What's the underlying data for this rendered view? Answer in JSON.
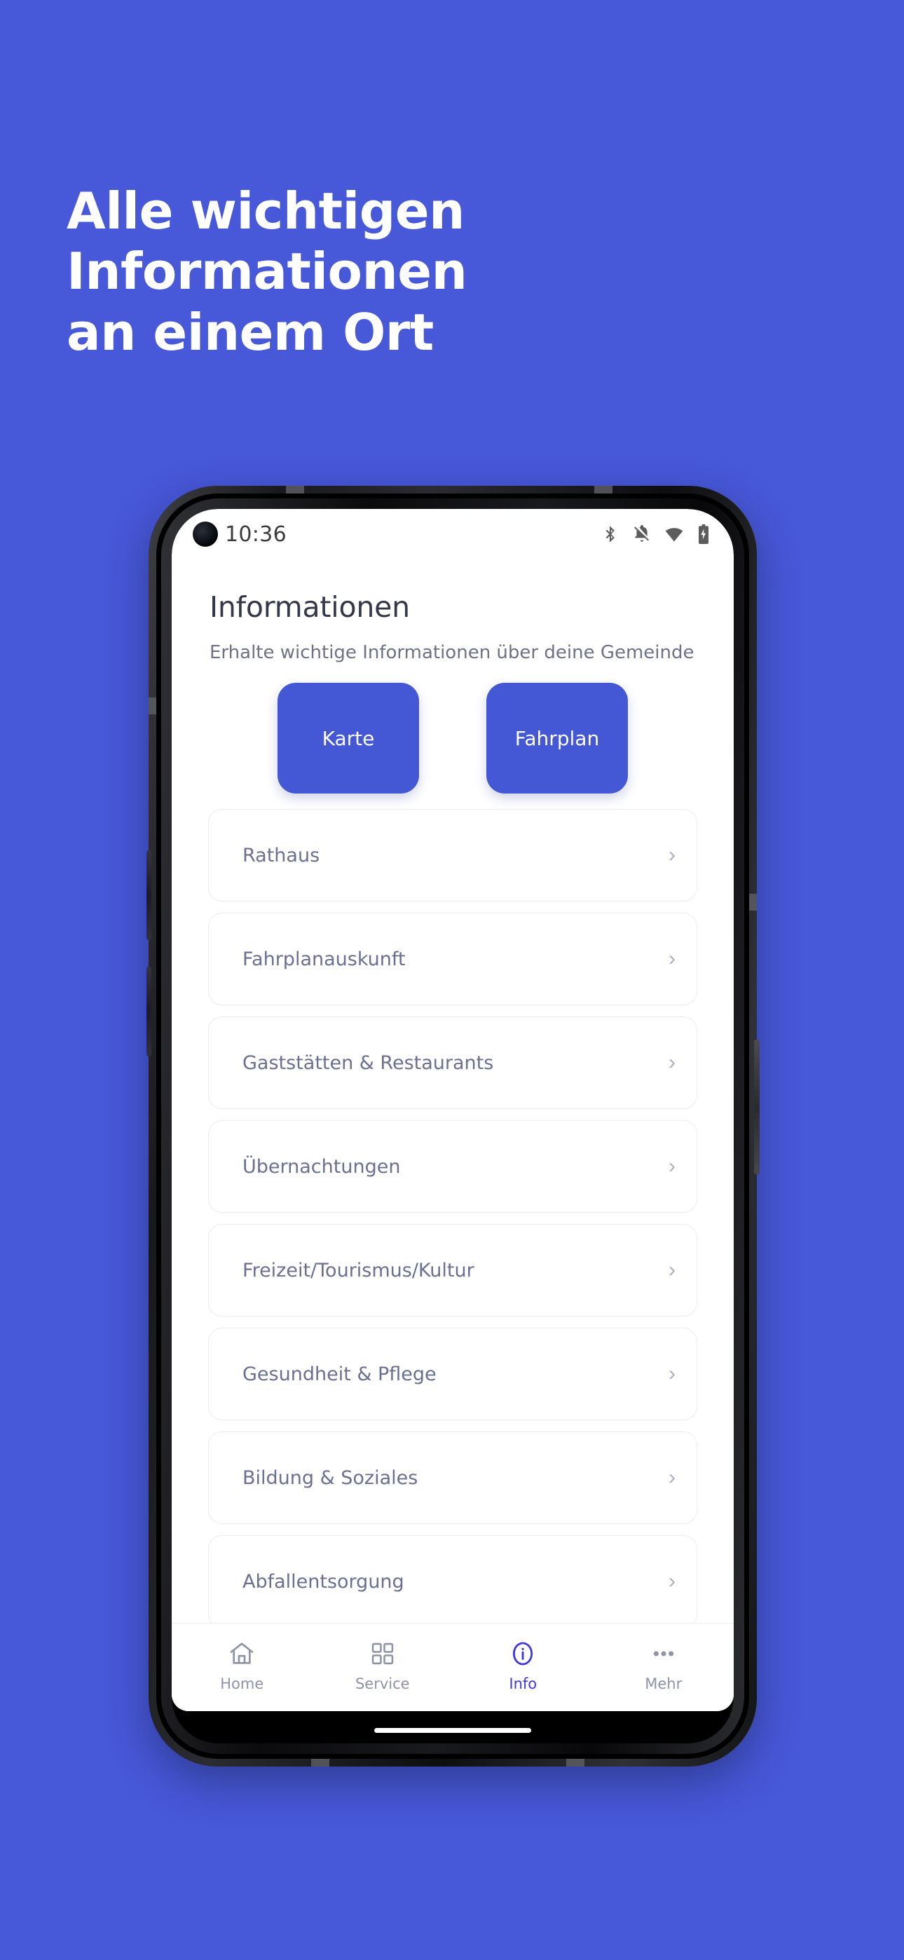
{
  "page": {
    "background_color": "#4758D8",
    "headline": "Alle wichtigen Informationen\nan einem Ort"
  },
  "phone": {
    "statusbar": {
      "time": "10:36",
      "icons": [
        "bluetooth-icon",
        "notifications-off-icon",
        "wifi-icon",
        "battery-charging-icon"
      ]
    },
    "app": {
      "title": "Informationen",
      "subtitle": "Erhalte wichtige Informationen über deine Gemeinde",
      "accent_color": "#4458D6",
      "actions": [
        {
          "label": "Karte"
        },
        {
          "label": "Fahrplan"
        }
      ],
      "list": [
        {
          "label": "Rathaus",
          "chevron": "›"
        },
        {
          "label": "Fahrplanauskunft",
          "chevron": "›"
        },
        {
          "label": "Gaststätten & Restaurants",
          "chevron": "›"
        },
        {
          "label": "Übernachtungen",
          "chevron": "›"
        },
        {
          "label": "Freizeit/Tourismus/Kultur",
          "chevron": "›"
        },
        {
          "label": "Gesundheit & Pflege",
          "chevron": "›"
        },
        {
          "label": "Bildung & Soziales",
          "chevron": "›"
        },
        {
          "label": "Abfallentsorgung",
          "chevron": "›"
        }
      ],
      "tabs": [
        {
          "label": "Home",
          "icon": "home-icon",
          "active": false
        },
        {
          "label": "Service",
          "icon": "grid-icon",
          "active": false
        },
        {
          "label": "Info",
          "icon": "info-circle-icon",
          "active": true
        },
        {
          "label": "Mehr",
          "icon": "more-dots-icon",
          "active": false
        }
      ],
      "active_tab_color": "#4037E0"
    }
  }
}
